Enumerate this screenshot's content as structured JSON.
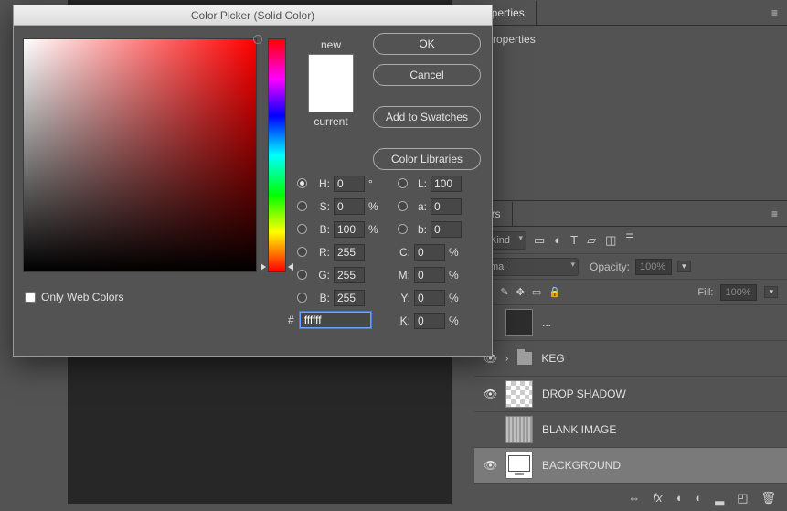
{
  "dialog": {
    "title": "Color Picker (Solid Color)",
    "new_label": "new",
    "current_label": "current",
    "buttons": {
      "ok": "OK",
      "cancel": "Cancel",
      "add_swatches": "Add to Swatches",
      "color_libraries": "Color Libraries"
    },
    "web_only_label": "Only Web Colors",
    "fields": {
      "H": {
        "label": "H:",
        "value": "0",
        "unit": "°"
      },
      "S": {
        "label": "S:",
        "value": "0",
        "unit": "%"
      },
      "Bv": {
        "label": "B:",
        "value": "100",
        "unit": "%"
      },
      "L": {
        "label": "L:",
        "value": "100"
      },
      "a": {
        "label": "a:",
        "value": "0"
      },
      "b": {
        "label": "b:",
        "value": "0"
      },
      "R": {
        "label": "R:",
        "value": "255"
      },
      "G": {
        "label": "G:",
        "value": "255"
      },
      "Bc": {
        "label": "B:",
        "value": "255"
      },
      "C": {
        "label": "C:",
        "value": "0",
        "unit": "%"
      },
      "M": {
        "label": "M:",
        "value": "0",
        "unit": "%"
      },
      "Y": {
        "label": "Y:",
        "value": "0",
        "unit": "%"
      },
      "K": {
        "label": "K:",
        "value": "0",
        "unit": "%"
      }
    },
    "hex_prefix": "#",
    "hex_value": "ffffff",
    "new_color": "#ffffff",
    "current_color": "#ffffff"
  },
  "right": {
    "properties_tab": "operties",
    "properties_label": "Properties",
    "layers_tab": "ers",
    "filter_kind": "Kind",
    "blend_mode": "mal",
    "opacity_label": "Opacity:",
    "opacity_value": "100%",
    "fill_label": "Fill:",
    "fill_value": "100%"
  },
  "layers": [
    {
      "name": "...",
      "type": "generic",
      "visible": false
    },
    {
      "name": "KEG",
      "type": "folder",
      "visible": true
    },
    {
      "name": "DROP SHADOW",
      "type": "checker",
      "visible": true
    },
    {
      "name": "BLANK IMAGE",
      "type": "striped",
      "visible": false
    },
    {
      "name": "BACKGROUND",
      "type": "monitor",
      "visible": true,
      "selected": true
    }
  ]
}
